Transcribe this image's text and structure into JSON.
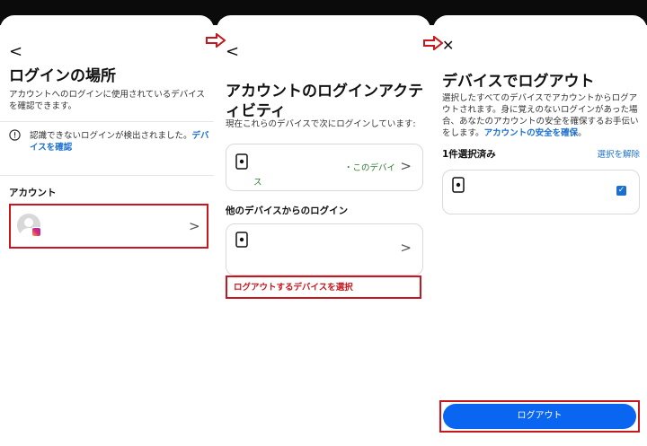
{
  "panel1": {
    "back": "<",
    "title": "ログインの場所",
    "description": "アカウントへのログインに使用されているデバイスを確認できます。",
    "alert_text": "認識できないログインが検出されました。",
    "alert_link": "デバイスを確認",
    "alert_icon": "exclamation-circle-icon",
    "section_label": "アカウント",
    "account_chevron": ">"
  },
  "panel2": {
    "back": "<",
    "title": "アカウントのログインアクティビティ",
    "subtitle": "現在これらのデバイスで次にログインしています:",
    "current_device_status": "・このデバイ",
    "current_device_status_cont": "ス",
    "other_label": "他のデバイスからのログイン",
    "select_link": "ログアウトするデバイスを選択",
    "chevron": ">"
  },
  "panel3": {
    "close": "✕",
    "title": "デバイスでログアウト",
    "description": "選択したすべてのデバイスでアカウントからログアウトされます。身に覚えのないログインがあった場合、あなたのアカウントの安全を確保するお手伝いをします。",
    "description_link": "アカウントの安全を確保",
    "description_end": "。",
    "selected_count": "1件選択済み",
    "deselect": "選択を解除",
    "logout_button": "ログアウト"
  },
  "colors": {
    "accent": "#1a6fd1",
    "annotation": "#c8161d",
    "logout_button": "#0a66f0",
    "alert_link": "#1a6fd1",
    "current_status": "#2e7d32"
  }
}
